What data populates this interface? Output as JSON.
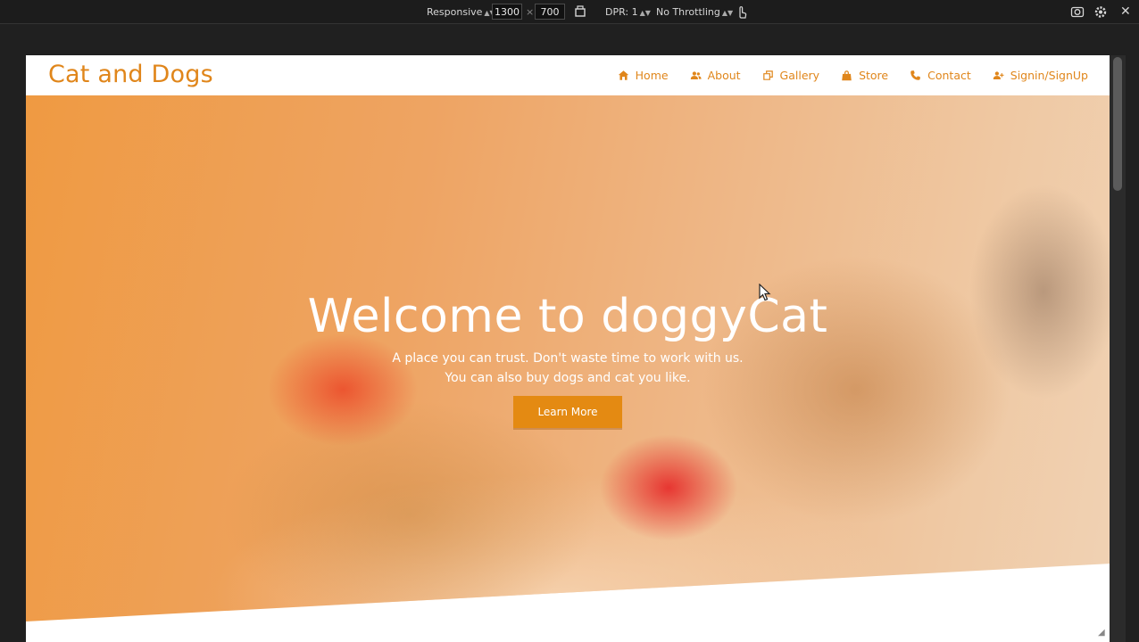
{
  "devtools": {
    "device_mode": "Responsive",
    "width": "1300",
    "times": "×",
    "height": "700",
    "dpr": "DPR: 1",
    "throttling": "No Throttling"
  },
  "site": {
    "brand": "Cat and Dogs",
    "nav": [
      {
        "label": "Home",
        "icon": "home-icon"
      },
      {
        "label": "About",
        "icon": "users-icon"
      },
      {
        "label": "Gallery",
        "icon": "gallery-icon"
      },
      {
        "label": "Store",
        "icon": "bag-icon"
      },
      {
        "label": "Contact",
        "icon": "phone-icon"
      },
      {
        "label": "Signin/SignUp",
        "icon": "user-add-icon"
      }
    ],
    "hero": {
      "title": "Welcome to doggyCat",
      "line1": "A place you can trust. Don't waste time to work with us.",
      "line2": "You can also buy dogs and cat you like.",
      "button": "Learn More"
    }
  },
  "colors": {
    "accent": "#e0861b",
    "button": "#e48a12"
  }
}
